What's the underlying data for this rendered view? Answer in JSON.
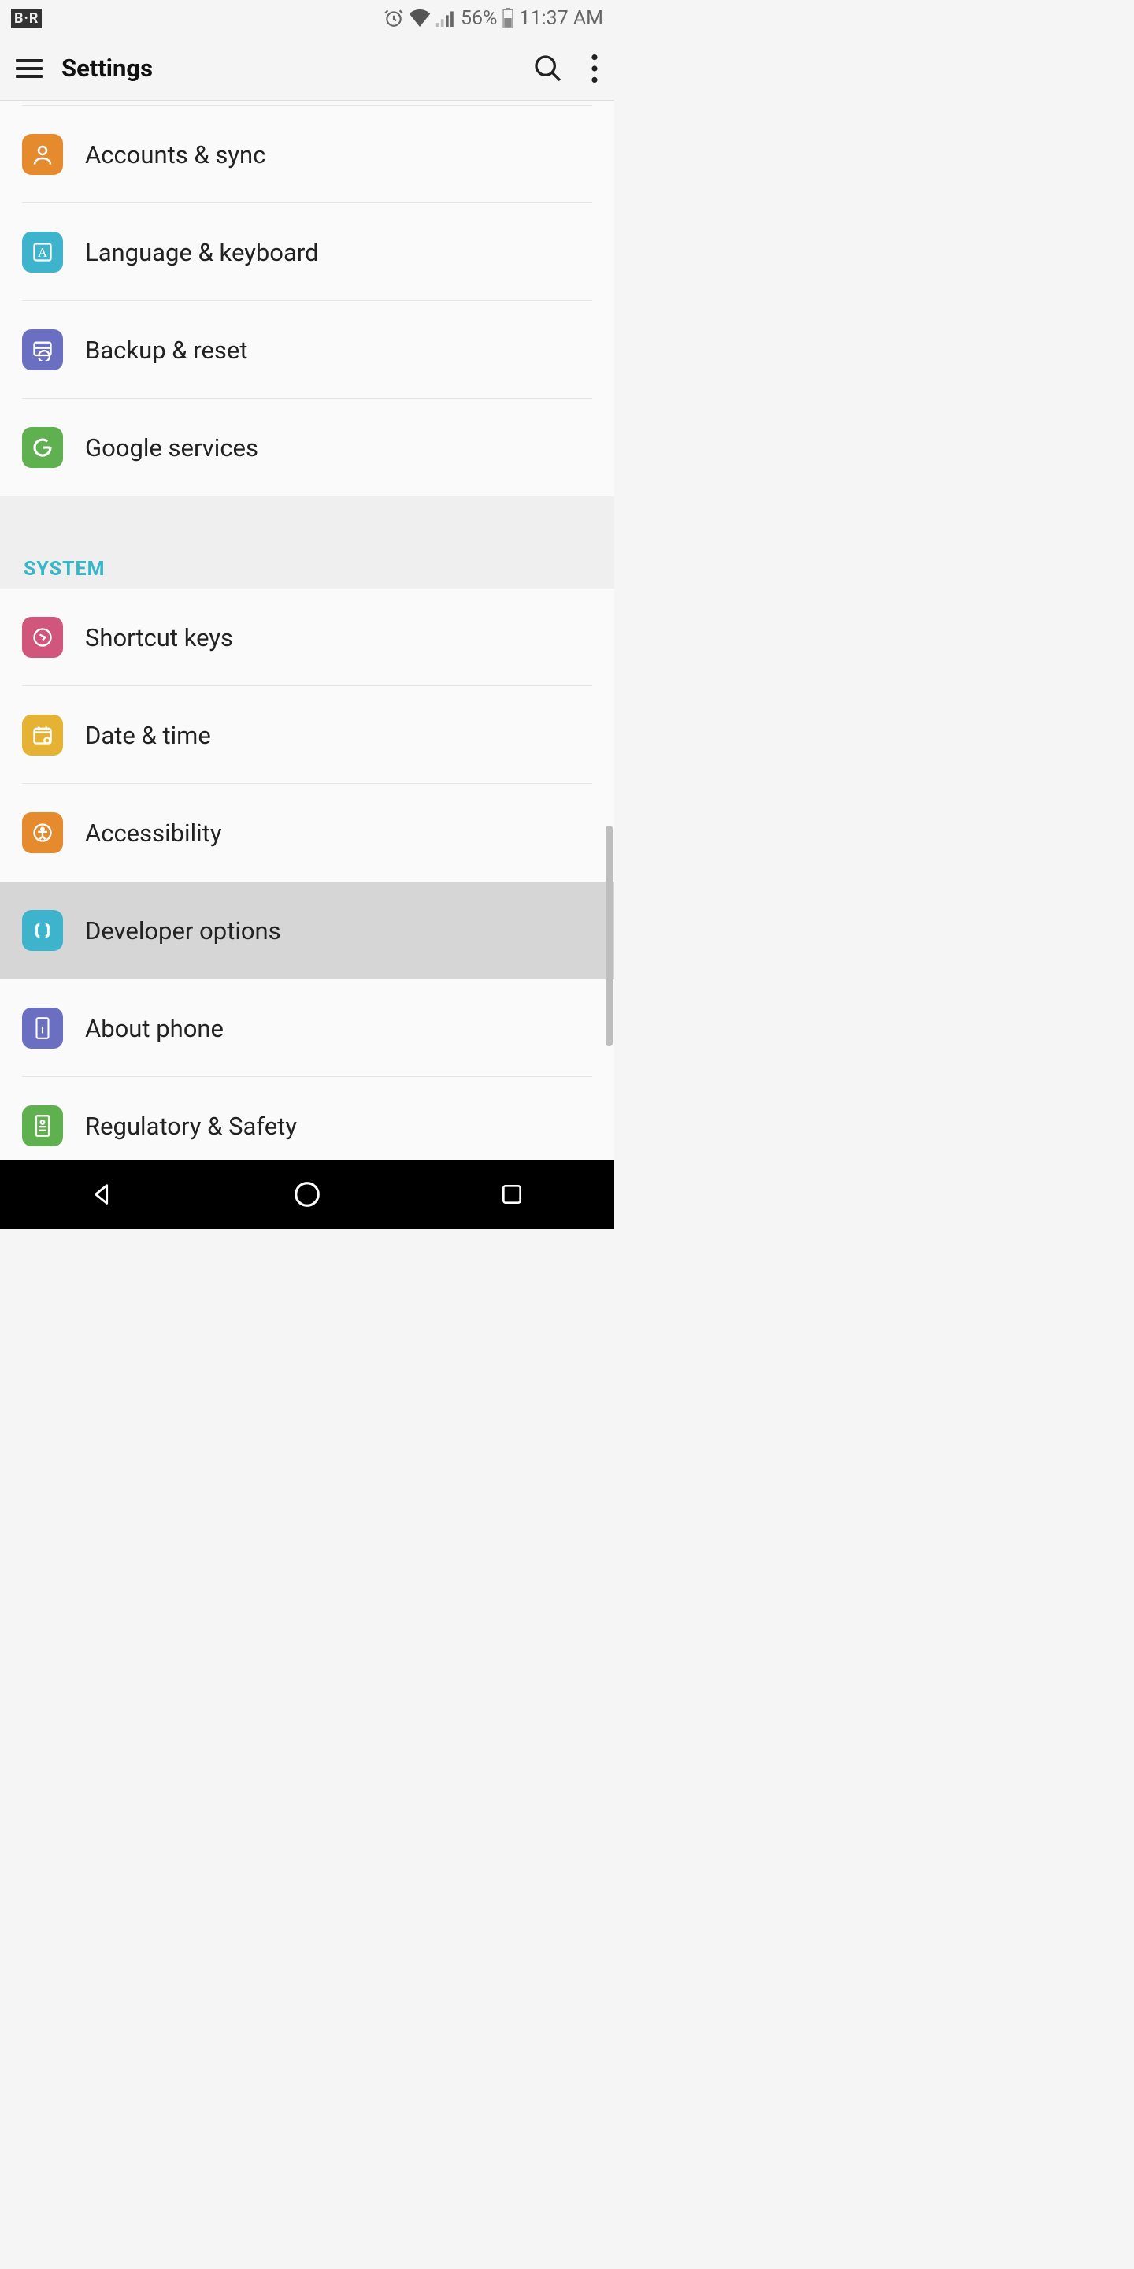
{
  "status": {
    "left_badge": "B·R",
    "alarm": true,
    "wifi": true,
    "signal": true,
    "battery_pct": "56%",
    "time": "11:37 AM"
  },
  "appbar": {
    "title": "Settings"
  },
  "section_header": "SYSTEM",
  "rows": {
    "partial_top": {
      "label": ""
    },
    "accounts": {
      "label": "Accounts & sync"
    },
    "language": {
      "label": "Language & keyboard"
    },
    "backup": {
      "label": "Backup & reset"
    },
    "google": {
      "label": "Google services"
    },
    "shortcut": {
      "label": "Shortcut keys"
    },
    "datetime": {
      "label": "Date & time"
    },
    "accessibility": {
      "label": "Accessibility"
    },
    "developer": {
      "label": "Developer options"
    },
    "about": {
      "label": "About phone"
    },
    "regulatory": {
      "label": "Regulatory & Safety"
    }
  },
  "icon_colors": {
    "partial_top": "#e5b233",
    "accounts": "#e68a2e",
    "language": "#3eb3cc",
    "backup": "#6a6fc1",
    "google": "#5fb04e",
    "shortcut": "#d1567c",
    "datetime": "#e5b233",
    "accessibility": "#e68a2e",
    "developer": "#3eb3cc",
    "about": "#6a6fc1",
    "regulatory": "#5fb04e"
  }
}
